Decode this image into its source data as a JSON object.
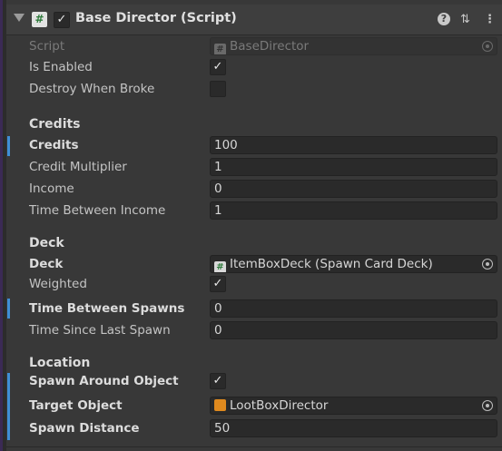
{
  "component": {
    "title": "Base Director (Script)",
    "enabled": true,
    "header_icons": [
      "help-icon",
      "preset-icon",
      "menu-icon"
    ]
  },
  "fields": {
    "script": {
      "label": "Script",
      "value": "BaseDirector"
    },
    "is_enabled": {
      "label": "Is Enabled",
      "checked": true
    },
    "destroy_when_broke": {
      "label": "Destroy When Broke",
      "checked": false
    }
  },
  "credits_section": {
    "title": "Credits",
    "credits": {
      "label": "Credits",
      "value": "100"
    },
    "credit_multiplier": {
      "label": "Credit Multiplier",
      "value": "1"
    },
    "income": {
      "label": "Income",
      "value": "0"
    },
    "time_between_income": {
      "label": "Time Between Income",
      "value": "1"
    }
  },
  "deck_section": {
    "title": "Deck",
    "deck": {
      "label": "Deck",
      "value": "ItemBoxDeck (Spawn Card Deck)"
    },
    "weighted": {
      "label": "Weighted",
      "checked": true
    },
    "time_between_spawns": {
      "label": "Time Between Spawns",
      "value": "0"
    },
    "time_since_last_spawn": {
      "label": "Time Since Last Spawn",
      "value": "0"
    }
  },
  "location_section": {
    "title": "Location",
    "spawn_around_object": {
      "label": "Spawn Around Object",
      "checked": true
    },
    "target_object": {
      "label": "Target Object",
      "value": "LootBoxDirector"
    },
    "spawn_distance": {
      "label": "Spawn Distance",
      "value": "50"
    }
  },
  "colors": {
    "accent_marker": "#3f8fd6",
    "background": "#383838",
    "field": "#2a2a2a"
  }
}
